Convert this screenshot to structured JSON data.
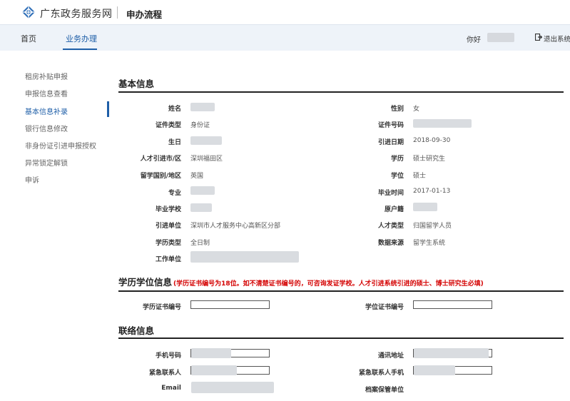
{
  "header": {
    "brand": "广东政务服务网",
    "page_title": "申办流程"
  },
  "nav": {
    "items": [
      {
        "label": "首页"
      },
      {
        "label": "业务办理"
      }
    ],
    "greeting": "你好",
    "logout": "退出系统"
  },
  "sidebar": {
    "items": [
      {
        "label": "租房补贴申报"
      },
      {
        "label": "申报信息查看"
      },
      {
        "label": "基本信息补录"
      },
      {
        "label": "银行信息修改"
      },
      {
        "label": "非身份证引进申报授权"
      },
      {
        "label": "异常锁定解锁"
      },
      {
        "label": "申诉"
      }
    ]
  },
  "basic": {
    "title": "基本信息",
    "left": [
      {
        "label": "姓名",
        "value": ""
      },
      {
        "label": "证件类型",
        "value": "身份证"
      },
      {
        "label": "生日",
        "value": ""
      },
      {
        "label": "人才引进市/区",
        "value": "深圳福田区"
      },
      {
        "label": "留学国别/地区",
        "value": "英国"
      },
      {
        "label": "专业",
        "value": ""
      },
      {
        "label": "毕业学校",
        "value": ""
      },
      {
        "label": "引进单位",
        "value": "深圳市人才服务中心高新区分部"
      },
      {
        "label": "学历类型",
        "value": "全日制"
      },
      {
        "label": "工作单位",
        "value": ""
      }
    ],
    "right": [
      {
        "label": "性别",
        "value": "女"
      },
      {
        "label": "证件号码",
        "value": ""
      },
      {
        "label": "引进日期",
        "value": "2018-09-30"
      },
      {
        "label": "学历",
        "value": "硕士研究生"
      },
      {
        "label": "学位",
        "value": "硕士"
      },
      {
        "label": "毕业时间",
        "value": "2017-01-13"
      },
      {
        "label": "原户籍",
        "value": ""
      },
      {
        "label": "人才类型",
        "value": "归国留学人员"
      },
      {
        "label": "数据来源",
        "value": "留学生系统"
      }
    ]
  },
  "education": {
    "title": "学历学位信息",
    "note": "(学历证书编号为18位。如不清楚证书编号的，可咨询发证学校。人才引进系统引进的硕士、博士研究生必填)",
    "diploma_label": "学历证书编号",
    "degree_label": "学位证书编号"
  },
  "contact": {
    "title": "联络信息",
    "mobile_label": "手机号码",
    "address_label": "通讯地址",
    "emergency_label": "紧急联系人",
    "emergency_mobile_label": "紧急联系人手机",
    "email_label": "Email",
    "archive_label": "档案保管单位"
  }
}
